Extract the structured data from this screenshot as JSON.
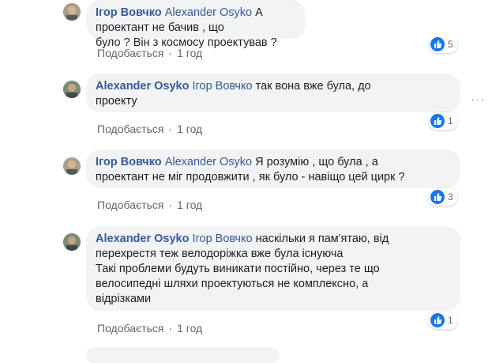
{
  "comments": [
    {
      "author": "Ігор Вовчко",
      "mention": "Alexander Osyko",
      "text_lines": [
        "А проектант не бачив , що",
        "було ? Він з космосу проектував ?"
      ],
      "like_label": "Подобається",
      "time": "1 год",
      "reaction_count": "5"
    },
    {
      "author": "Alexander Osyko",
      "mention": "Ігор Вовчко",
      "text_lines": [
        "так вона вже була, до",
        "проекту"
      ],
      "like_label": "Подобається",
      "time": "1 год",
      "reaction_count": "1"
    },
    {
      "author": "Ігор Вовчко",
      "mention": "Alexander Osyko",
      "text_lines": [
        "Я розумію , що була , а",
        "проектант не міг продовжити , як було - навіщо цей цирк ?"
      ],
      "like_label": "Подобається",
      "time": "1 год",
      "reaction_count": "3"
    },
    {
      "author": "Alexander Osyko",
      "mention": "Ігор Вовчко",
      "text_lines": [
        "наскільки я пам'ятаю, від",
        "перехрестя теж велодоріжка вже була існуюча",
        "Такі проблеми будуть виникати постійно, через те що",
        "велосипедні шляхи проектуються не комплексно, а",
        "відрізками"
      ],
      "like_label": "Подобається",
      "time": "1 год",
      "reaction_count": "1"
    }
  ],
  "more_options": "···",
  "colors": {
    "link": "#385898",
    "bubble": "#f2f3f5",
    "like_blue": "#1877f2",
    "meta": "#606770"
  },
  "icons": [
    "avatar",
    "like-icon",
    "more-options-icon"
  ]
}
